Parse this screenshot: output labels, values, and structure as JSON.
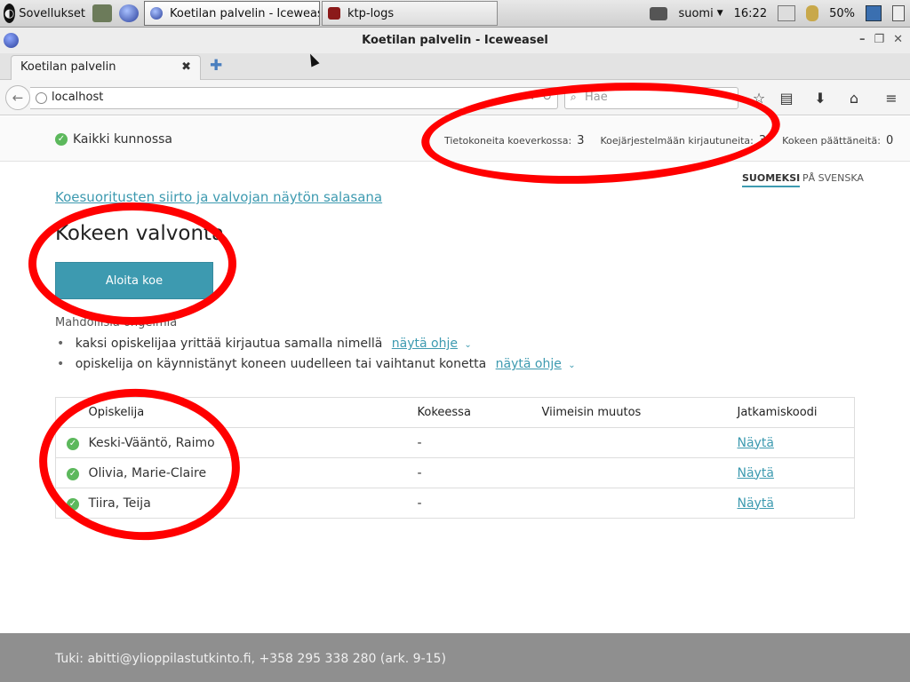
{
  "taskbar": {
    "apps_label": "Sovellukset",
    "windows": [
      {
        "label": "Koetilan palvelin - Iceweasel",
        "active": true
      },
      {
        "label": "ktp-logs",
        "active": false
      }
    ],
    "keyboard_layout": "suomi",
    "clock": "16:22",
    "battery": "50%"
  },
  "window": {
    "title": "Koetilan palvelin - Iceweasel"
  },
  "browser": {
    "tab_label": "Koetilan palvelin",
    "url": "localhost",
    "search_placeholder": "Hae"
  },
  "status": {
    "ok_text": "Kaikki kunnossa",
    "stats": [
      {
        "label": "Tietokoneita koeverkossa:",
        "value": "3"
      },
      {
        "label": "Koejärjestelmään kirjautuneita:",
        "value": "3"
      },
      {
        "label": "Kokeen päättäneitä:",
        "value": "0"
      }
    ]
  },
  "languages": {
    "fi": "SUOMEKSI",
    "sv": "PÅ SVENSKA"
  },
  "page": {
    "top_link": "Koesuoritusten siirto ja valvojan näytön salasana",
    "heading": "Kokeen valvonta",
    "start_button": "Aloita koe",
    "problems_heading": "Mahdollisia ongelmia",
    "problems": [
      {
        "text": "kaksi opiskelijaa yrittää kirjautua samalla nimellä",
        "help": "näytä ohje"
      },
      {
        "text": "opiskelija on käynnistänyt koneen uudelleen tai vaihtanut konetta",
        "help": "näytä ohje"
      }
    ]
  },
  "table": {
    "headers": [
      "Opiskelija",
      "Kokeessa",
      "Viimeisin muutos",
      "Jatkamiskoodi"
    ],
    "rows": [
      {
        "name": "Keski-Vääntö, Raimo",
        "in_exam": "-",
        "last_change": "",
        "code": "Näytä"
      },
      {
        "name": "Olivia, Marie-Claire",
        "in_exam": "-",
        "last_change": "",
        "code": "Näytä"
      },
      {
        "name": "Tiira, Teija",
        "in_exam": "-",
        "last_change": "",
        "code": "Näytä"
      }
    ]
  },
  "footer": {
    "text": "Tuki: abitti@ylioppilastutkinto.fi, +358 295 338 280 (ark. 9-15)"
  },
  "colors": {
    "accent": "#3d9ab0",
    "ok_green": "#5cb85c",
    "annotation_red": "#ff0000",
    "footer_bg": "#8f8f8f"
  }
}
